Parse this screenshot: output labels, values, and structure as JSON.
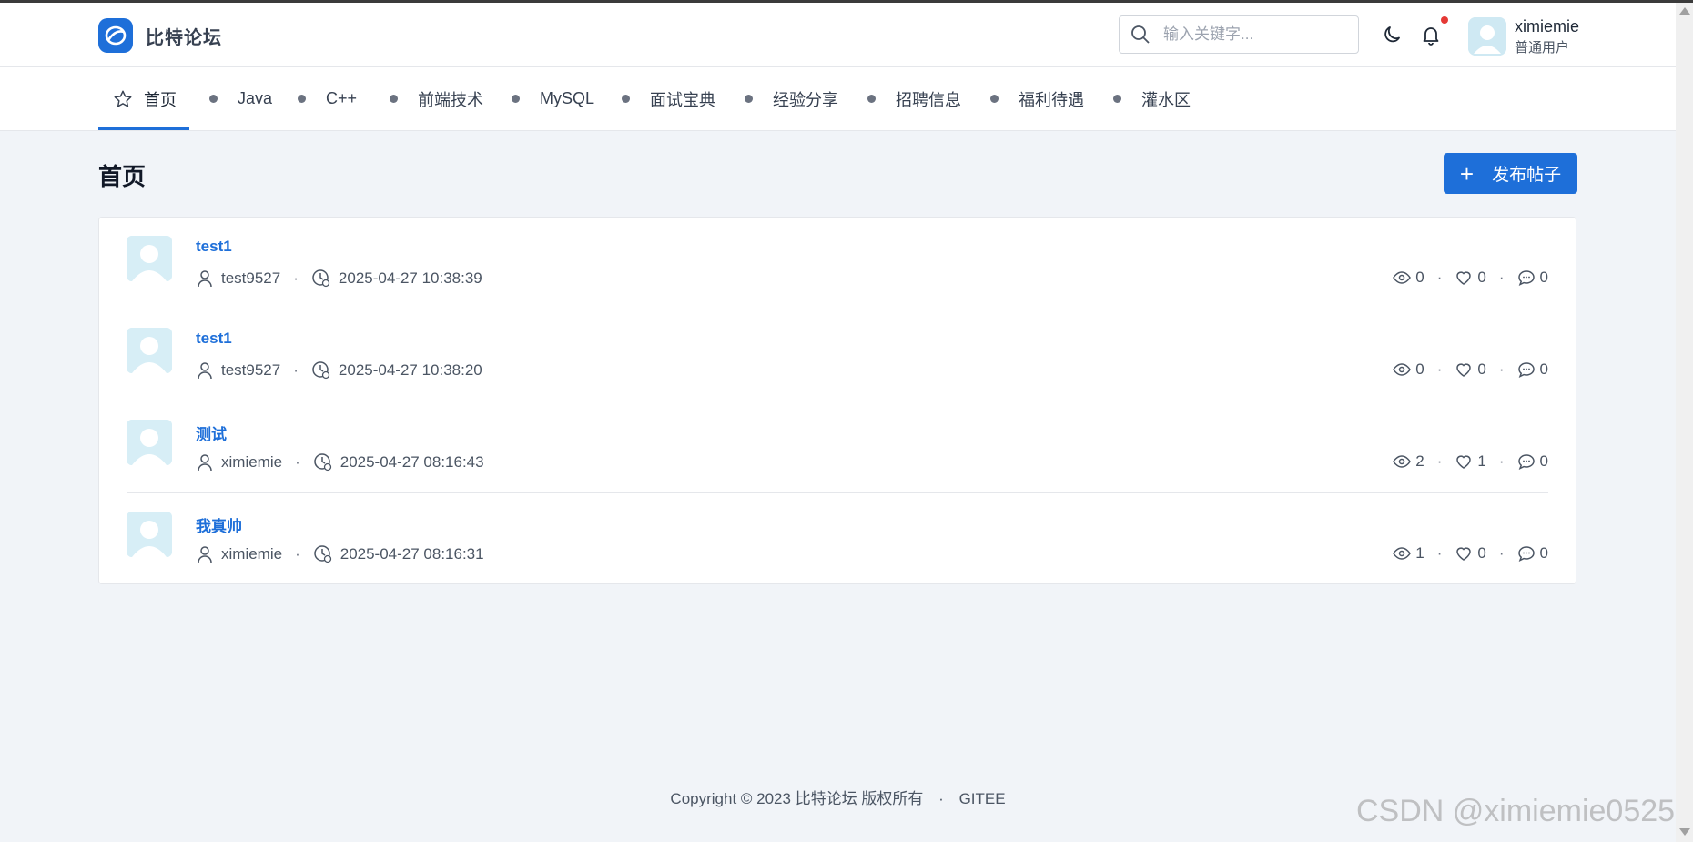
{
  "brand": {
    "name": "比特论坛",
    "accent": "#1e6fd9"
  },
  "search": {
    "placeholder": "输入关键字..."
  },
  "user": {
    "name": "ximiemie",
    "role": "普通用户"
  },
  "nav": {
    "items": [
      {
        "label": "首页",
        "icon": "star-icon",
        "active": true
      },
      {
        "label": "Java"
      },
      {
        "label": "C++"
      },
      {
        "label": "前端技术"
      },
      {
        "label": "MySQL"
      },
      {
        "label": "面试宝典"
      },
      {
        "label": "经验分享"
      },
      {
        "label": "招聘信息"
      },
      {
        "label": "福利待遇"
      },
      {
        "label": "灌水区"
      }
    ]
  },
  "page": {
    "title": "首页",
    "publish_label": "发布帖子"
  },
  "posts": [
    {
      "title": "test1",
      "author": "test9527",
      "time": "2025-04-27 10:38:39",
      "views": "0",
      "likes": "0",
      "comments": "0"
    },
    {
      "title": "test1",
      "author": "test9527",
      "time": "2025-04-27 10:38:20",
      "views": "0",
      "likes": "0",
      "comments": "0"
    },
    {
      "title": "测试",
      "author": "ximiemie",
      "time": "2025-04-27 08:16:43",
      "views": "2",
      "likes": "1",
      "comments": "0"
    },
    {
      "title": "我真帅",
      "author": "ximiemie",
      "time": "2025-04-27 08:16:31",
      "views": "1",
      "likes": "0",
      "comments": "0"
    }
  ],
  "footer": {
    "copyright": "Copyright © 2023 比特论坛 版权所有",
    "separator": "·",
    "link": "GITEE"
  },
  "watermark": "CSDN @ximiemie0525"
}
